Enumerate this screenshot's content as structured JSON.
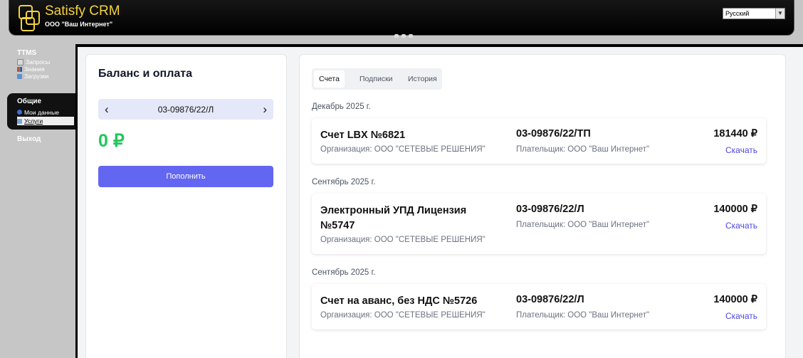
{
  "header": {
    "app_title": "Satisfy CRM",
    "org_name": "ООО \"Ваш Интернет\"",
    "language": "Русский",
    "brand_color": "#f3d23d"
  },
  "sidebar": {
    "ttms_title": "TTMS",
    "ttms_items": [
      {
        "label": "Запросы",
        "icon": "document-icon"
      },
      {
        "label": "Знания",
        "icon": "books-icon"
      },
      {
        "label": "Загрузки",
        "icon": "download-icon"
      }
    ],
    "general_title": "Общие",
    "general_items": [
      {
        "label": "Мои данные",
        "icon": "info-icon"
      },
      {
        "label": "Услуги",
        "icon": "services-icon",
        "active": true
      }
    ],
    "exit_label": "Выход"
  },
  "balance": {
    "title": "Баланс и оплата",
    "account_number": "03-09876/22/Л",
    "amount": "0 ₽",
    "topup_label": "Пополнить",
    "amount_color": "#22c55e",
    "button_color": "#6366f1"
  },
  "tabs": [
    {
      "label": "Счета",
      "active": true
    },
    {
      "label": "Подписки",
      "active": false
    },
    {
      "label": "История",
      "active": false
    }
  ],
  "invoices": [
    {
      "month": "Декабрь 2025 г.",
      "name": "Счет LBX №6821",
      "organization": "Организация: ООО \"СЕТЕВЫЕ РЕШЕНИЯ\"",
      "contract": "03-09876/22/ТП",
      "payer": "Плательщик: ООО \"Ваш Интернет\"",
      "amount": "181440 ₽",
      "download_label": "Скачать"
    },
    {
      "month": "Сентябрь 2025 г.",
      "name": "Электронный УПД Лицензия №5747",
      "organization": "Организация: ООО \"СЕТЕВЫЕ РЕШЕНИЯ\"",
      "contract": "03-09876/22/Л",
      "payer": "Плательщик: ООО \"Ваш Интернет\"",
      "amount": "140000 ₽",
      "download_label": "Скачать"
    },
    {
      "month": "Сентябрь 2025 г.",
      "name": "Счет на аванс, без НДС №5726",
      "organization": "Организация: ООО \"СЕТЕВЫЕ РЕШЕНИЯ\"",
      "contract": "03-09876/22/Л",
      "payer": "Плательщик: ООО \"Ваш Интернет\"",
      "amount": "140000 ₽",
      "download_label": "Скачать"
    }
  ]
}
